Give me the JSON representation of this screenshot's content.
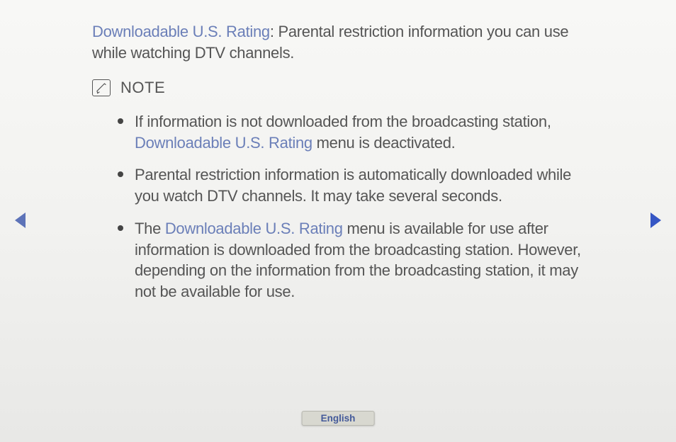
{
  "intro": {
    "term": "Downloadable U.S. Rating",
    "rest": ": Parental restriction information you can use while watching DTV channels."
  },
  "note_label": "NOTE",
  "bullets": [
    {
      "segments": [
        {
          "t": "If information is not downloaded from the broadcasting station, ",
          "highlight": false
        },
        {
          "t": "Downloadable U.S. Rating",
          "highlight": true
        },
        {
          "t": " menu is deactivated.",
          "highlight": false
        }
      ]
    },
    {
      "segments": [
        {
          "t": "Parental restriction information is automatically downloaded while you watch DTV channels. It may take several seconds.",
          "highlight": false
        }
      ]
    },
    {
      "segments": [
        {
          "t": "The ",
          "highlight": false
        },
        {
          "t": "Downloadable U.S. Rating",
          "highlight": true
        },
        {
          "t": " menu is available for use after information is downloaded from the broadcasting station. However, depending on the information from the broadcasting station, it may not be available for use.",
          "highlight": false
        }
      ]
    }
  ],
  "language": "English"
}
